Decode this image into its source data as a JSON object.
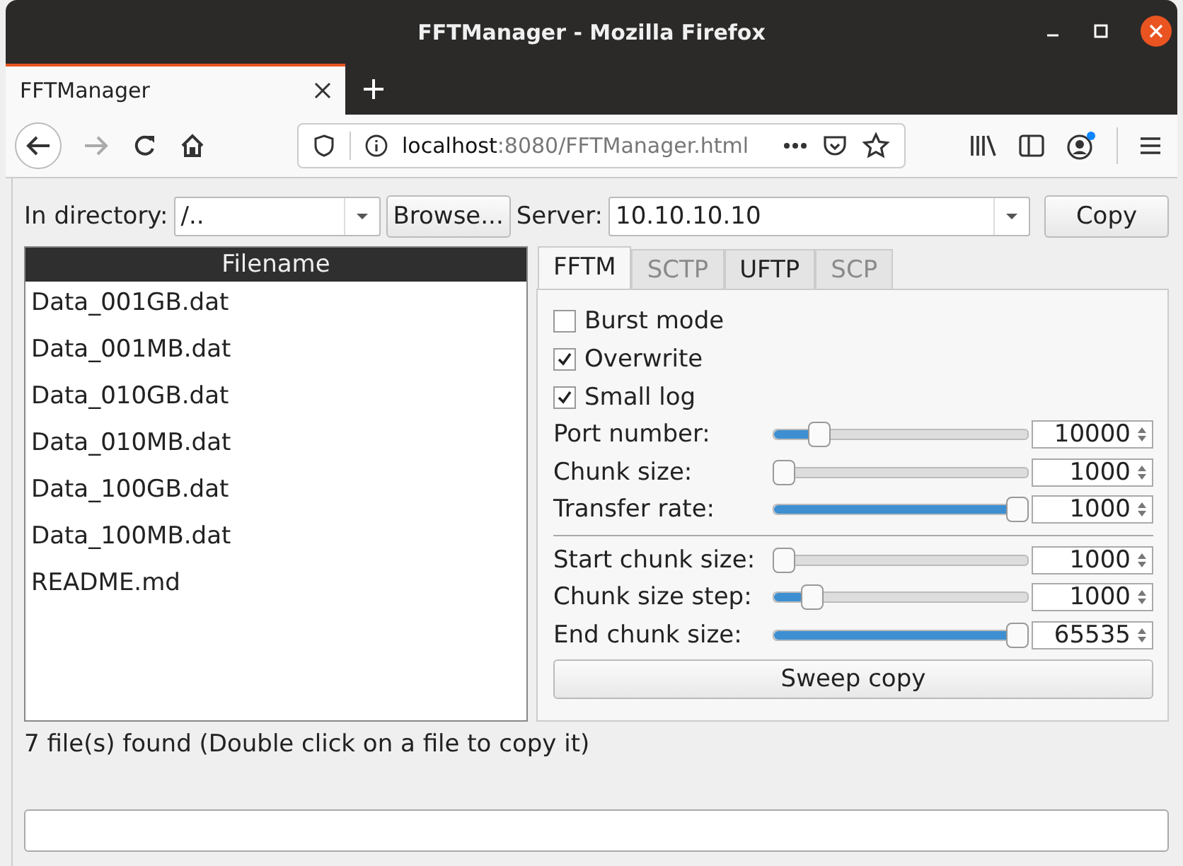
{
  "window": {
    "title": "FFTManager - Mozilla Firefox"
  },
  "browser_tab": {
    "label": "FFTManager"
  },
  "address_bar": {
    "host": "localhost",
    "rest": ":8080/FFTManager.html"
  },
  "directory": {
    "label": "In directory:",
    "value": "/.."
  },
  "browse_button": "Browse...",
  "server": {
    "label": "Server:",
    "value": "10.10.10.10"
  },
  "copy_button": "Copy",
  "file_list": {
    "header": "Filename",
    "files": [
      "Data_001GB.dat",
      "Data_001MB.dat",
      "Data_010GB.dat",
      "Data_010MB.dat",
      "Data_100GB.dat",
      "Data_100MB.dat",
      "README.md"
    ]
  },
  "tabs": [
    {
      "label": "FFTM",
      "selected": true,
      "disabled": false
    },
    {
      "label": "SCTP",
      "selected": false,
      "disabled": true
    },
    {
      "label": "UFTP",
      "selected": false,
      "disabled": false
    },
    {
      "label": "SCP",
      "selected": false,
      "disabled": true
    }
  ],
  "options": [
    {
      "label": "Burst mode",
      "checked": false
    },
    {
      "label": "Overwrite",
      "checked": true
    },
    {
      "label": "Small log",
      "checked": true
    }
  ],
  "settings": [
    {
      "label": "Port number:",
      "level": 0.15,
      "value": "10000"
    },
    {
      "label": "Chunk size:",
      "level": 0.0,
      "value": "1000"
    },
    {
      "label": "Transfer rate:",
      "level": 1.0,
      "value": "1000"
    }
  ],
  "sweep": [
    {
      "label": "Start chunk size:",
      "level": 0.0,
      "value": "1000"
    },
    {
      "label": "Chunk size step:",
      "level": 0.12,
      "value": "1000"
    },
    {
      "label": "End chunk size:",
      "level": 1.0,
      "value": "65535"
    }
  ],
  "sweep_button": "Sweep copy",
  "status": "7 file(s) found (Double click on a file to copy it)"
}
